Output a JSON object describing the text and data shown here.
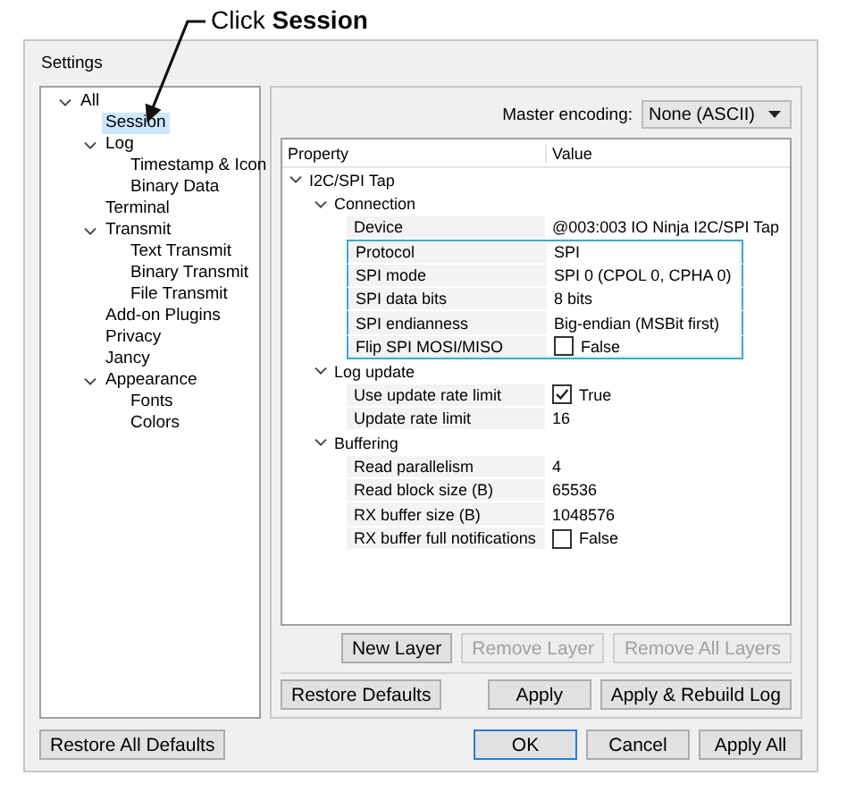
{
  "callout": "Click **Session**",
  "window": {
    "title": "Settings"
  },
  "tree": [
    {
      "label": "All",
      "expanded": true,
      "selected": false,
      "children": [
        {
          "label": "Session",
          "selected": true
        },
        {
          "label": "Log",
          "expanded": true,
          "selected": false,
          "children": [
            {
              "label": "Timestamp & Icon",
              "selected": false
            },
            {
              "label": "Binary Data",
              "selected": false
            }
          ]
        },
        {
          "label": "Terminal",
          "selected": false
        },
        {
          "label": "Transmit",
          "expanded": true,
          "selected": false,
          "children": [
            {
              "label": "Text Transmit",
              "selected": false
            },
            {
              "label": "Binary Transmit",
              "selected": false
            },
            {
              "label": "File Transmit",
              "selected": false
            }
          ]
        },
        {
          "label": "Add-on Plugins",
          "selected": false
        },
        {
          "label": "Privacy",
          "selected": false
        },
        {
          "label": "Jancy",
          "selected": false
        },
        {
          "label": "Appearance",
          "expanded": true,
          "selected": false,
          "children": [
            {
              "label": "Fonts",
              "selected": false
            },
            {
              "label": "Colors",
              "selected": false
            }
          ]
        }
      ]
    }
  ],
  "encoding": {
    "label": "Master encoding:",
    "value": "None (ASCII)"
  },
  "grid": {
    "columns": [
      "Property",
      "Value"
    ],
    "rows": [
      {
        "label": "I2C/SPI Tap",
        "expanded": true,
        "children": [
          {
            "label": "Connection",
            "expanded": true,
            "children": [
              {
                "label": "Device",
                "kind": "text",
                "value": "@003:003 IO Ninja I2C/SPI Tap",
                "highlighted": false
              },
              {
                "label": "Protocol",
                "kind": "text",
                "value": "SPI",
                "highlighted": true
              },
              {
                "label": "SPI mode",
                "kind": "text",
                "value": "SPI 0 (CPOL 0, CPHA 0)",
                "highlighted": true
              },
              {
                "label": "SPI data bits",
                "kind": "text",
                "value": "8 bits",
                "highlighted": true
              },
              {
                "label": "SPI endianness",
                "kind": "text",
                "value": "Big-endian (MSBit first)",
                "highlighted": true
              },
              {
                "label": "Flip SPI MOSI/MISO",
                "kind": "checkbox",
                "checked": false,
                "value": "False",
                "highlighted": true
              }
            ]
          },
          {
            "label": "Log update",
            "expanded": true,
            "children": [
              {
                "label": "Use update rate limit",
                "kind": "checkbox",
                "checked": true,
                "value": "True",
                "highlighted": false
              },
              {
                "label": "Update rate limit",
                "kind": "text",
                "value": "16",
                "highlighted": false
              }
            ]
          },
          {
            "label": "Buffering",
            "expanded": true,
            "children": [
              {
                "label": "Read parallelism",
                "kind": "text",
                "value": "4",
                "highlighted": false
              },
              {
                "label": "Read block size (B)",
                "kind": "text",
                "value": "65536",
                "highlighted": false
              },
              {
                "label": "RX buffer size (B)",
                "kind": "text",
                "value": "1048576",
                "highlighted": false
              },
              {
                "label": "RX buffer full notifications",
                "kind": "checkbox",
                "checked": false,
                "value": "False",
                "highlighted": false
              }
            ]
          }
        ]
      }
    ]
  },
  "layer_buttons": [
    {
      "label": "New Layer",
      "disabled": false
    },
    {
      "label": "Remove Layer",
      "disabled": true
    },
    {
      "label": "Remove All Layers",
      "disabled": true
    }
  ],
  "page_buttons": {
    "left": [
      {
        "label": "Restore Defaults",
        "disabled": false
      }
    ],
    "right": [
      {
        "label": "Apply",
        "disabled": false
      },
      {
        "label": "Apply & Rebuild Log",
        "disabled": false
      }
    ]
  },
  "dialog_buttons": {
    "left": [
      {
        "label": "Restore All Defaults",
        "default": false
      }
    ],
    "right": [
      {
        "label": "OK",
        "default": true
      },
      {
        "label": "Cancel",
        "default": false
      },
      {
        "label": "Apply All",
        "default": false
      }
    ]
  }
}
